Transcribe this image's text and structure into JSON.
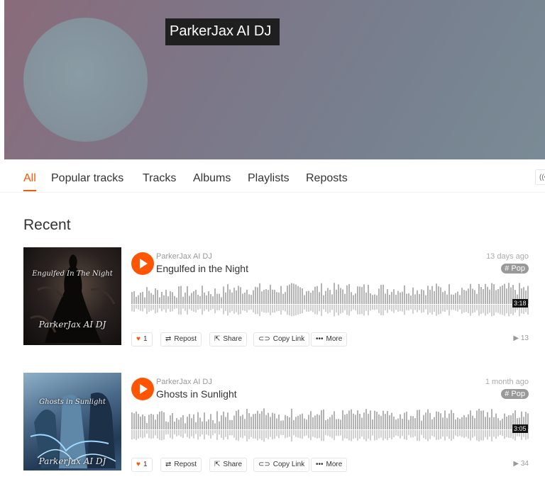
{
  "hero": {
    "title": "ParkerJax AI DJ"
  },
  "tabs": [
    {
      "label": "All",
      "active": true
    },
    {
      "label": "Popular tracks"
    },
    {
      "label": "Tracks"
    },
    {
      "label": "Albums"
    },
    {
      "label": "Playlists"
    },
    {
      "label": "Reposts"
    }
  ],
  "section": {
    "title": "Recent"
  },
  "tracks": [
    {
      "artist": "ParkerJax AI DJ",
      "title": "Engulfed in the Night",
      "ago": "13 days ago",
      "tag": "# Pop",
      "duration": "3:18",
      "likes": "1",
      "plays": "13",
      "art_title": "Engulfed In The Night",
      "art_sig": "ParkerJax AI DJ"
    },
    {
      "artist": "ParkerJax AI DJ",
      "title": "Ghosts in Sunlight",
      "ago": "1 month ago",
      "tag": "# Pop",
      "duration": "3:05",
      "likes": "1",
      "plays": "34",
      "art_title": "Ghosts in Sunlight",
      "art_sig": "ParkerJax AI DJ"
    }
  ],
  "actions": {
    "repost": "Repost",
    "share": "Share",
    "copy_link": "Copy Link",
    "more": "More"
  },
  "icons": {
    "heart": "heart-icon",
    "repost": "repost-icon",
    "share": "share-icon",
    "link": "link-icon",
    "more": "more-icon",
    "play": "play-icon"
  },
  "colors": {
    "accent": "#ff5500",
    "tag_bg": "#999999",
    "wave": "#b3b3b3"
  }
}
